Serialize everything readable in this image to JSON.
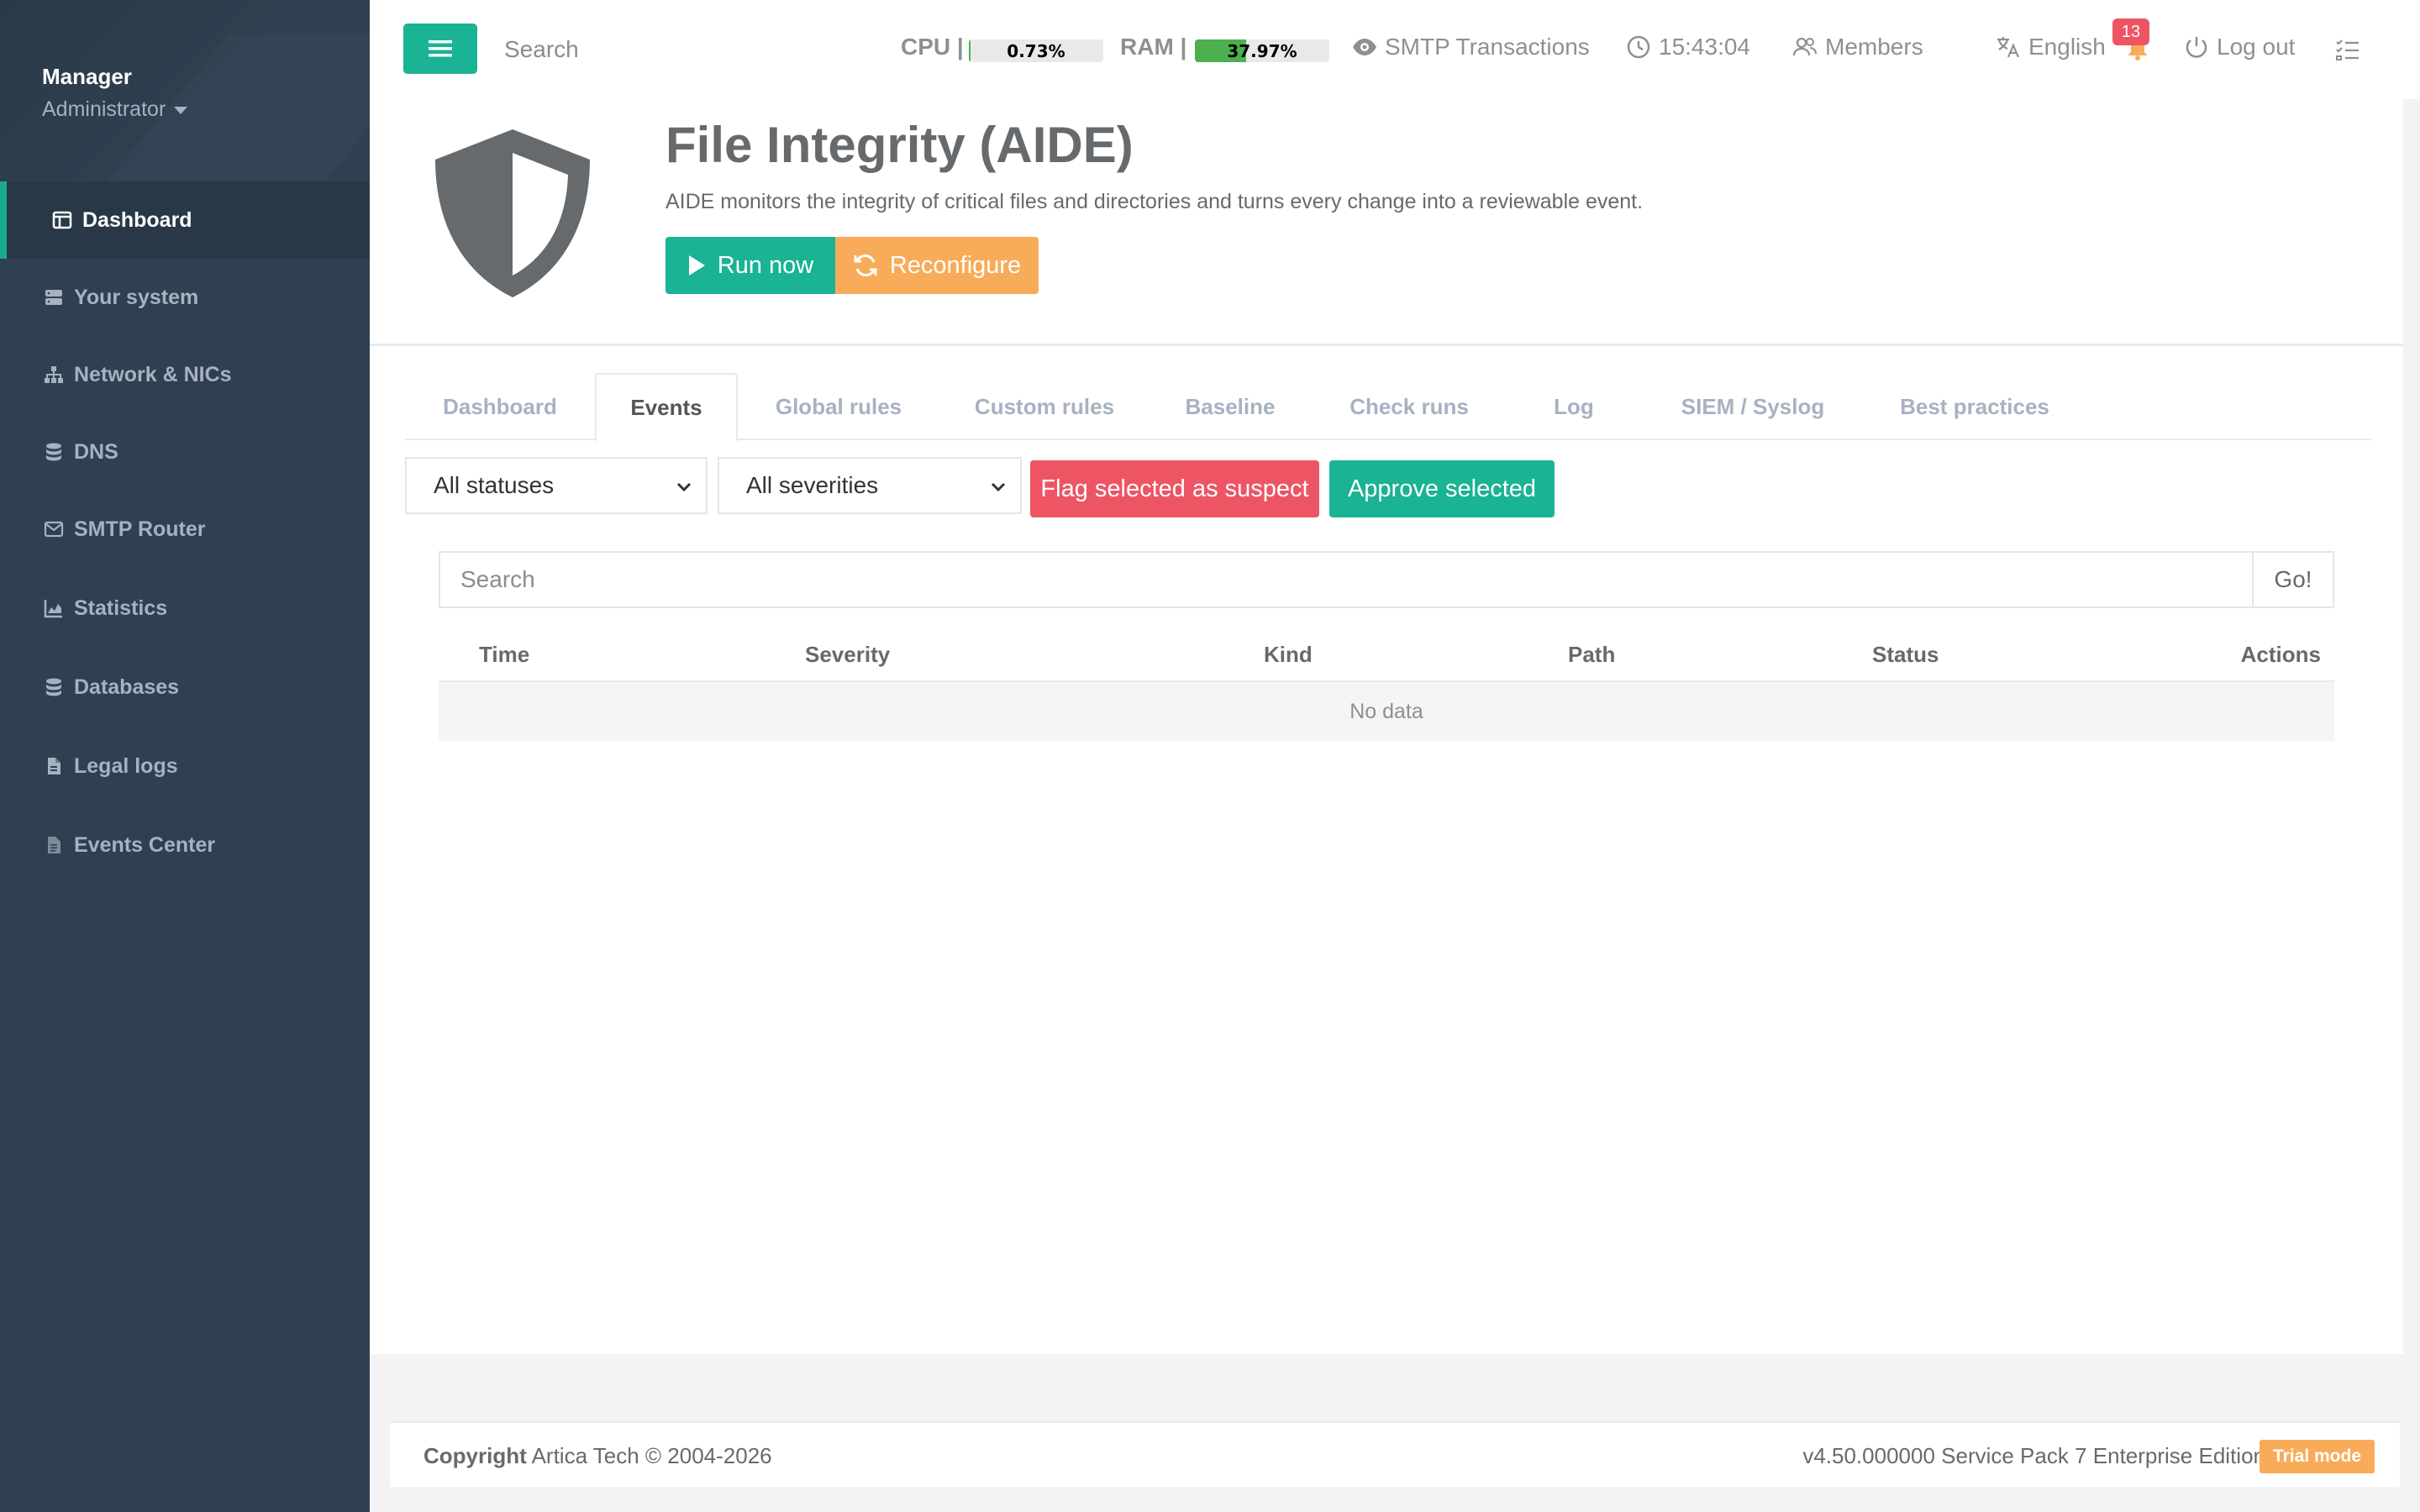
{
  "sidebar": {
    "profile": {
      "name": "Manager",
      "role": "Administrator"
    },
    "items": [
      {
        "label": "Dashboard",
        "icon": "dashboard-icon",
        "active": true
      },
      {
        "label": "Your system",
        "icon": "server-icon"
      },
      {
        "label": "Network & NICs",
        "icon": "sitemap-icon"
      },
      {
        "label": "DNS",
        "icon": "database-icon"
      },
      {
        "label": "SMTP Router",
        "icon": "envelope-icon"
      },
      {
        "label": "Statistics",
        "icon": "chart-icon"
      },
      {
        "label": "Databases",
        "icon": "database-icon"
      },
      {
        "label": "Legal logs",
        "icon": "file-icon"
      },
      {
        "label": "Events Center",
        "icon": "document-icon"
      }
    ]
  },
  "topbar": {
    "search_placeholder": "Search",
    "cpu": {
      "label": "CPU",
      "value": "0.73%",
      "percent": 0.73
    },
    "ram": {
      "label": "RAM",
      "value": "37.97%",
      "percent": 37.97
    },
    "smtp_label": "SMTP Transactions",
    "time": "15:43:04",
    "members_label": "Members",
    "language_label": "English",
    "notification_count": "13",
    "logout_label": "Log out"
  },
  "header": {
    "title": "File Integrity (AIDE)",
    "description": "AIDE monitors the integrity of critical files and directories and turns every change into a reviewable event.",
    "run_label": "Run now",
    "reconfigure_label": "Reconfigure"
  },
  "tabs": [
    {
      "label": "Dashboard"
    },
    {
      "label": "Events",
      "active": true
    },
    {
      "label": "Global rules"
    },
    {
      "label": "Custom rules"
    },
    {
      "label": "Baseline"
    },
    {
      "label": "Check runs"
    },
    {
      "label": "Log"
    },
    {
      "label": "SIEM / Syslog"
    },
    {
      "label": "Best practices"
    }
  ],
  "filters": {
    "status_selected": "All statuses",
    "severity_selected": "All severities",
    "flag_label": "Flag selected as suspect",
    "approve_label": "Approve selected"
  },
  "table": {
    "search_placeholder": "Search",
    "go_label": "Go!",
    "columns": [
      "Time",
      "Severity",
      "Kind",
      "Path",
      "Status",
      "Actions"
    ],
    "empty_text": "No data"
  },
  "footer": {
    "copyright_strong": "Copyright",
    "copyright_text": "Artica Tech © 2004-2026",
    "version": "v4.50.000000 Service Pack 7 Enterprise Edition",
    "badge": "Trial mode"
  },
  "colors": {
    "primary": "#1ab394",
    "warning": "#f8ac59",
    "danger": "#ed5565",
    "sidebar": "#2f4050",
    "meter_fill": "#4caf50"
  }
}
